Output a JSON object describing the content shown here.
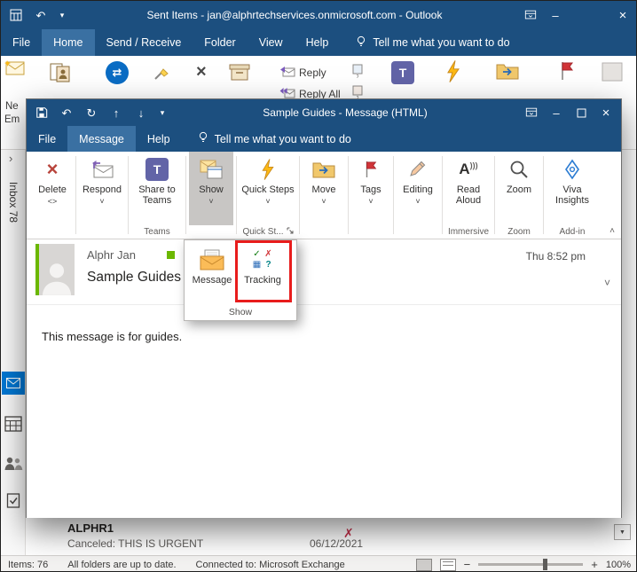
{
  "colors": {
    "titlebar_bg": "#1c4f7f",
    "tab_selected_bg": "#3a70a2",
    "pressed_button_bg": "#c8c6c4",
    "annotation_red": "#e81c1c",
    "presence_green": "#6bb700",
    "teams_purple": "#6264a7",
    "nav_mail_blue": "#0078d4",
    "statusbar_bg": "#f3f2f1"
  },
  "main_window": {
    "title": "Sent Items - jan@alphrtechservices.onmicrosoft.com - Outlook",
    "tabs": {
      "items": [
        "File",
        "Home",
        "Send / Receive",
        "Folder",
        "View",
        "Help"
      ],
      "selected": "Home",
      "tell_me": "Tell me what you want to do"
    },
    "ribbon": {
      "new_email_line1": "Ne",
      "new_email_line2": "Em",
      "reply": "Reply",
      "reply_all": "Reply All"
    },
    "sidebar": {
      "inbox_label": "Inbox 78"
    },
    "list_item": {
      "sender": "ALPHR1",
      "preview": "Canceled: THIS IS URGENT",
      "date": "06/12/2021"
    },
    "statusbar": {
      "items_count": "Items: 76",
      "sync_status": "All folders are up to date.",
      "connection": "Connected to: Microsoft Exchange",
      "zoom_level": "100%"
    }
  },
  "message_window": {
    "title": "Sample Guides - Message (HTML)",
    "tabs": {
      "items": [
        "File",
        "Message",
        "Help"
      ],
      "selected": "Message",
      "tell_me": "Tell me what you want to do"
    },
    "ribbon": {
      "buttons": [
        {
          "label": "Delete",
          "group": ""
        },
        {
          "label": "Respond",
          "group": ""
        },
        {
          "label": "Share to Teams",
          "group": "Teams"
        },
        {
          "label": "Show",
          "group": ""
        },
        {
          "label": "Quick Steps",
          "group": "Quick St..."
        },
        {
          "label": "Move",
          "group": ""
        },
        {
          "label": "Tags",
          "group": ""
        },
        {
          "label": "Editing",
          "group": ""
        },
        {
          "label": "Read Aloud",
          "group": "Immersive"
        },
        {
          "label": "Zoom",
          "group": "Zoom"
        },
        {
          "label": "Viva Insights",
          "group": "Add-in"
        }
      ]
    },
    "show_dropdown": {
      "items": [
        {
          "label": "Message",
          "highlighted": false
        },
        {
          "label": "Tracking",
          "highlighted": true
        }
      ],
      "group_label": "Show"
    },
    "email": {
      "sender": "Alphr Jan",
      "subject": "Sample Guides",
      "received": "Thu 8:52 pm",
      "body": "This message is for guides."
    }
  }
}
